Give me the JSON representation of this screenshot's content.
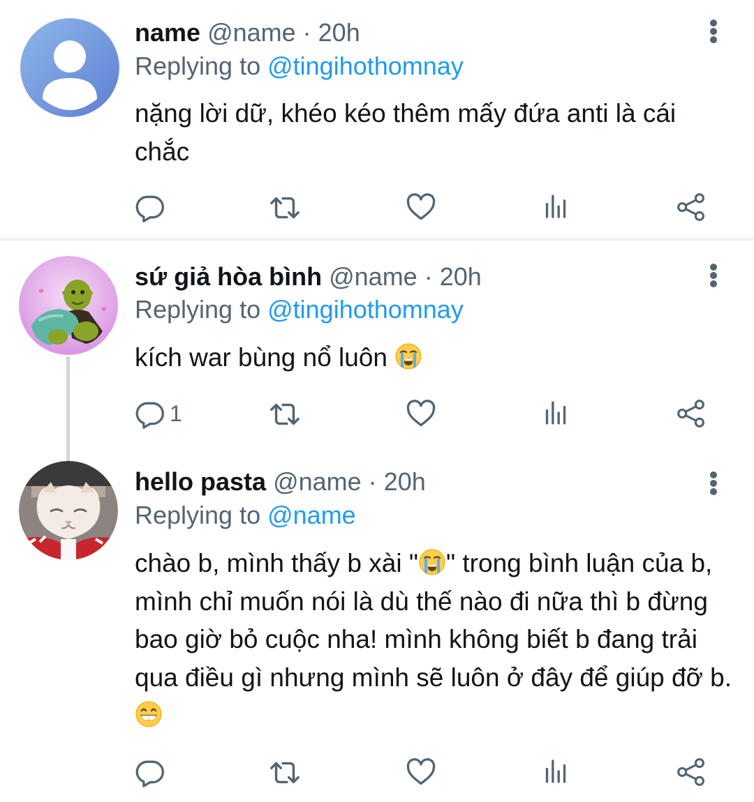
{
  "colors": {
    "accent": "#1d9bf0",
    "muted": "#536471",
    "text": "#0f1419"
  },
  "tweets": [
    {
      "display_name": "name",
      "meta": "@name · 20h",
      "reply_prefix": "Replying to ",
      "reply_to": "@tingihothomnay",
      "text": "nặng lời dữ, khéo kéo thêm mấy đứa anti là cái chắc",
      "reply_count": "",
      "avatar": "default-avatar-icon"
    },
    {
      "display_name": "sứ giả hòa bình",
      "meta": "@name · 20h",
      "reply_prefix": "Replying to ",
      "reply_to": "@tingihothomnay",
      "text": "kích war bùng nổ luôn",
      "text_emoji": "loudly-crying-face-emoji",
      "reply_count": "1",
      "avatar": "shrek-avatar"
    },
    {
      "display_name": "hello pasta",
      "meta": "@name · 20h",
      "reply_prefix": "Replying to ",
      "reply_to": "@name",
      "text_part1": "chào b, mình thấy b xài \"",
      "text_emoji1": "loudly-crying-face-emoji",
      "text_part2": "\" trong bình luận của b, mình chỉ muốn nói là dù thế nào đi nữa thì b đừng bao giờ bỏ cuộc nha! mình không biết b đang trải qua điều gì nhưng mình sẽ luôn ở đây để giúp đỡ b.",
      "text_emoji2": "grinning-face-emoji",
      "reply_count": "",
      "avatar": "cat-avatar"
    }
  ],
  "action_icons": [
    "reply-icon",
    "retweet-icon",
    "like-icon",
    "views-icon",
    "share-icon"
  ]
}
